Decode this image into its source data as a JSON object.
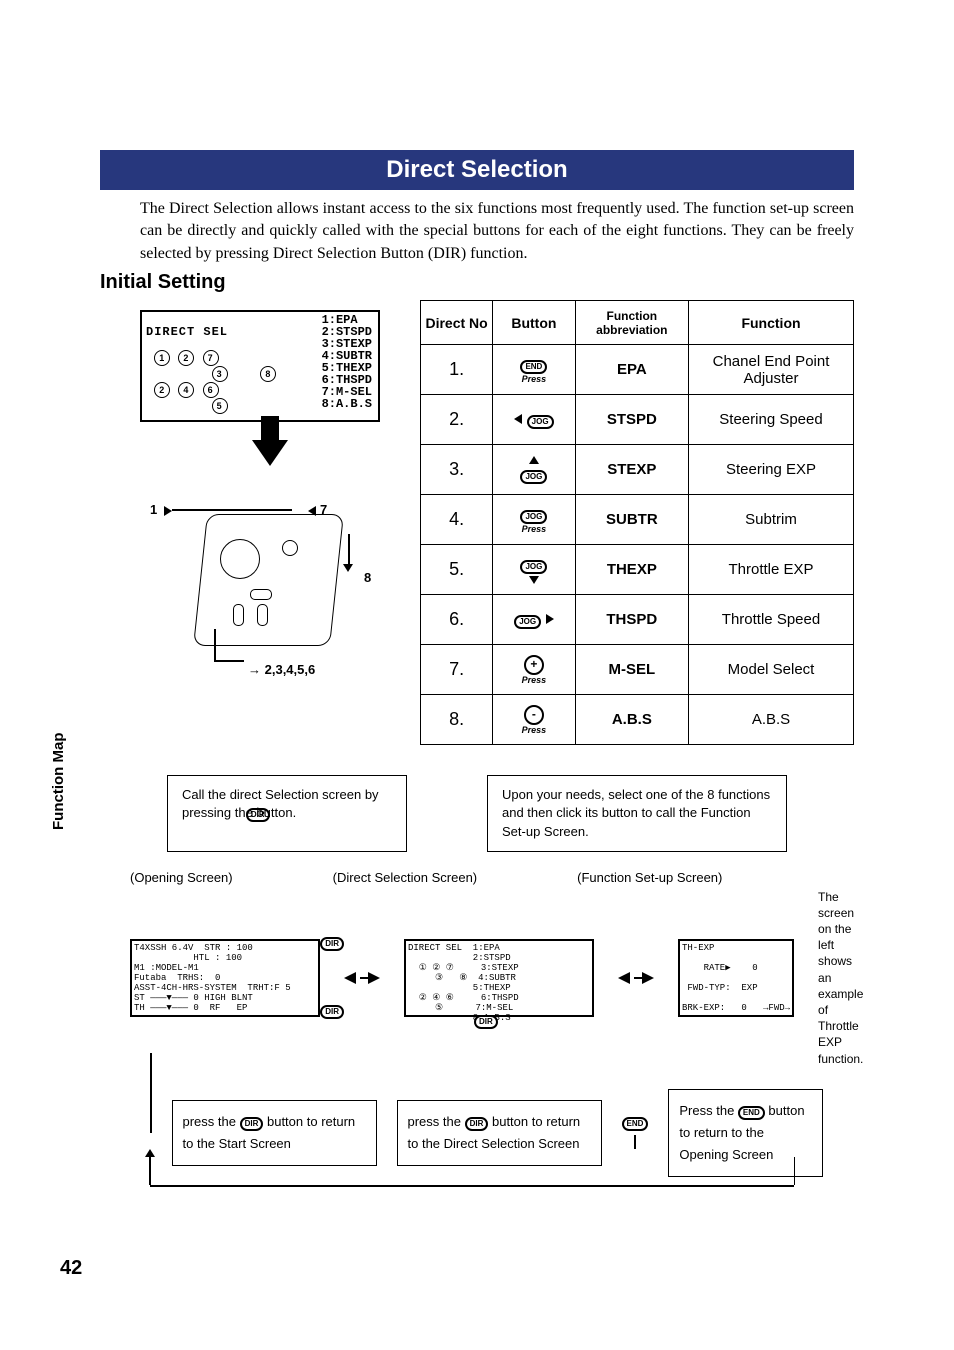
{
  "title": "Direct Selection",
  "intro": "The Direct Selection allows instant access to the six functions most frequently used. The function set-up screen can be directly and quickly called with the special buttons for each of the eight functions. They can be freely selected by pressing Direct Selection Button (DIR) function.",
  "subheading": "Initial Setting",
  "lcd": {
    "title": "DIRECT SEL",
    "items": [
      "1:EPA",
      "2:STSPD",
      "3:STEXP",
      "4:SUBTR",
      "5:THEXP",
      "6:THSPD",
      "7:M-SEL",
      "8:A.B.S"
    ]
  },
  "diagram_labels": {
    "one": "1",
    "seven": "7",
    "eight": "8",
    "group": "2,3,4,5,6"
  },
  "table": {
    "headers": {
      "no": "Direct No",
      "button": "Button",
      "abbr": "Function abbreviation",
      "func": "Function"
    },
    "rows": [
      {
        "no": "1.",
        "btn": "END",
        "arrow": "",
        "press": true,
        "abbr": "EPA",
        "func": "Chanel End Point Adjuster"
      },
      {
        "no": "2.",
        "btn": "JOG",
        "arrow": "left",
        "press": false,
        "abbr": "STSPD",
        "func": "Steering Speed"
      },
      {
        "no": "3.",
        "btn": "JOG",
        "arrow": "up",
        "press": false,
        "abbr": "STEXP",
        "func": "Steering EXP"
      },
      {
        "no": "4.",
        "btn": "JOG",
        "arrow": "",
        "press": true,
        "abbr": "SUBTR",
        "func": "Subtrim"
      },
      {
        "no": "5.",
        "btn": "JOG",
        "arrow": "down",
        "press": false,
        "abbr": "THEXP",
        "func": "Throttle EXP"
      },
      {
        "no": "6.",
        "btn": "JOG",
        "arrow": "right",
        "press": false,
        "abbr": "THSPD",
        "func": "Throttle Speed"
      },
      {
        "no": "7.",
        "btn": "+",
        "arrow": "",
        "press": true,
        "abbr": "M-SEL",
        "func": "Model Select"
      },
      {
        "no": "8.",
        "btn": "-",
        "arrow": "",
        "press": true,
        "abbr": "A.B.S",
        "func": "A.B.S"
      }
    ]
  },
  "flow": {
    "box1": "Call the direct Selection screen by pressing the       button.",
    "box1_icon": "DIR",
    "box2": "Upon your needs, select one of the 8 functions and then click its button to call the Function Set-up Screen.",
    "label_open": "(Opening Screen)",
    "label_dir": "(Direct Selection Screen)",
    "label_setup": "(Function Set-up Screen)",
    "note_right": "The screen on the left shows an example of Throttle EXP function.",
    "bottom1_a": "press the ",
    "bottom1_b": " button to return to the Start Screen",
    "bottom2_a": "press the ",
    "bottom2_b": " button to return to the Direct Selection Screen",
    "end_a": "Press the ",
    "end_b": " button to return to the Opening Screen",
    "dir_icon": "DIR",
    "end_icon": "END"
  },
  "mini_screens": {
    "open": "T4XSSH 6.4V  STR : 100\n           HTL : 100\nM1 :MODEL-M1\nFutaba  TRHS:  0\nASST-4CH-HRS-SYSTEM  TRHT:F 5\nST ———▼——— 0 HIGH BLNT\nTH ———▼——— 0  RF   EP",
    "dir": "DIRECT SEL  1:EPA\n            2:STSPD\n  ① ② ⑦     3:STEXP\n     ③   ⑧  4:SUBTR\n            5:THEXP\n  ② ④ ⑥     6:THSPD\n     ⑤      7:M-SEL\n            8:A.B.S",
    "setup": "TH-EXP\n\n    RATE▶    0\n\n FWD-TYP:  EXP\n\nBRK-EXP:   0   →FWD→"
  },
  "side_label": "Function Map",
  "page_number": "42"
}
